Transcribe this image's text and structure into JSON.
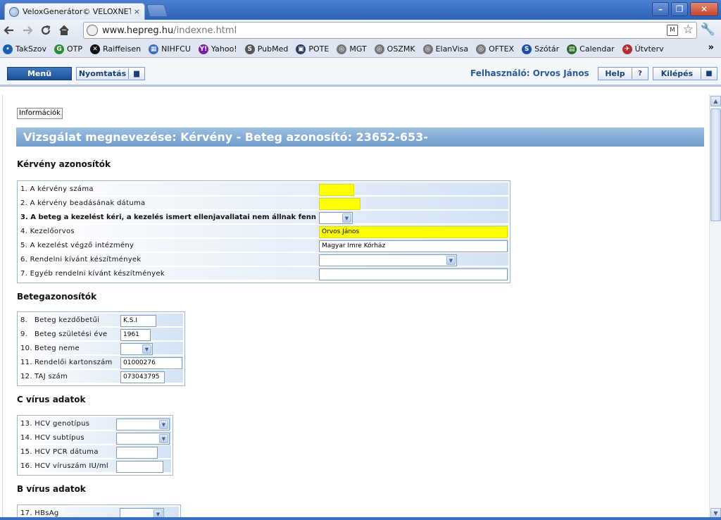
{
  "browser": {
    "tab_title": "VeloxGenerátor© VELOXNET K",
    "tab_close": "×",
    "url_host": "www.hepreg.hu",
    "url_path": "/indexne.html",
    "ext_label": "M",
    "win_min": "–",
    "win_max": "❐",
    "win_close": "✕",
    "bookmarks": [
      {
        "label": "TakSzov",
        "color": "#1a5fb4",
        "glyph": "•"
      },
      {
        "label": "OTP",
        "color": "#2e8b3a",
        "glyph": "G"
      },
      {
        "label": "Raiffeisen",
        "color": "#111111",
        "glyph": "✕"
      },
      {
        "label": "NIHFCU",
        "color": "#3b6cc7",
        "glyph": "▦"
      },
      {
        "label": "Yahoo!",
        "color": "#7b1fa2",
        "glyph": "Y!"
      },
      {
        "label": "PubMed",
        "color": "#555555",
        "glyph": "S"
      },
      {
        "label": "POTE",
        "color": "#2c3e66",
        "glyph": "▣"
      },
      {
        "label": "MGT",
        "color": "#777777",
        "glyph": "◎"
      },
      {
        "label": "OSZMK",
        "color": "#777777",
        "glyph": "◎"
      },
      {
        "label": "ElanVisa",
        "color": "#777777",
        "glyph": "◎"
      },
      {
        "label": "OFTEX",
        "color": "#777777",
        "glyph": "◎"
      },
      {
        "label": "Szótár",
        "color": "#1a4fa8",
        "glyph": "S"
      },
      {
        "label": "Calendar",
        "color": "#2d6a2d",
        "glyph": "▤"
      },
      {
        "label": "Útvterv",
        "color": "#b03030",
        "glyph": "✈"
      }
    ],
    "bookmarks_more": "»"
  },
  "app": {
    "menu_label": "Menü",
    "print_label": "Nyomtatás",
    "print_icon": "▆",
    "user_label": "Felhasználó: Orvos János",
    "help_label": "Help",
    "help_icon": "?",
    "exit_label": "Kilépés",
    "exit_icon": "■"
  },
  "page": {
    "info_button": "Információk",
    "title": "Vizsgálat megnevezése: Kérvény - Beteg azonosító: 23652-653-"
  },
  "sections": {
    "s1_title": "Kérvény azonosítók",
    "s1_rows": [
      {
        "label": "1. A kérvény száma",
        "value": ""
      },
      {
        "label": "2. A kérvény beadásának dátuma",
        "value": ""
      },
      {
        "label": "3. A beteg a kezelést kéri, a kezelés ismert ellenjavallatai nem állnak fenn",
        "value": ""
      },
      {
        "label": "4. Kezelőorvos",
        "value": "Orvos János"
      },
      {
        "label": "5. A kezelést végző intézmény",
        "value": "Magyar Imre Kórház"
      },
      {
        "label": "6. Rendelni kívánt készítmények",
        "value": ""
      },
      {
        "label": "7. Egyéb rendelni kívánt készítmények",
        "value": ""
      }
    ],
    "s2_title": "Betegazonosítók",
    "s2_rows": [
      {
        "num": "8.",
        "label": "Beteg kezdőbetűi",
        "value": "K.S.I"
      },
      {
        "num": "9.",
        "label": "Beteg születési éve",
        "value": "1961"
      },
      {
        "num": "10.",
        "label": "Beteg neme",
        "value": ""
      },
      {
        "num": "11.",
        "label": "Rendelői kartonszám",
        "value": "01000276"
      },
      {
        "num": "12.",
        "label": "TAJ szám",
        "value": "073043795"
      }
    ],
    "s3_title": "C vírus adatok",
    "s3_rows": [
      {
        "label": "13. HCV genotípus",
        "value": ""
      },
      {
        "label": "14. HCV subtípus",
        "value": ""
      },
      {
        "label": "15. HCV PCR dátuma",
        "value": ""
      },
      {
        "label": "16. HCV víruszám IU/ml",
        "value": ""
      }
    ],
    "s4_title": "B vírus adatok",
    "s4_rows": [
      {
        "label": "17. HBsAg",
        "value": ""
      }
    ]
  },
  "colors": {
    "required_field": "#ffff00",
    "title_band": "#7fa8d4",
    "menu_button": "#1f5499"
  }
}
